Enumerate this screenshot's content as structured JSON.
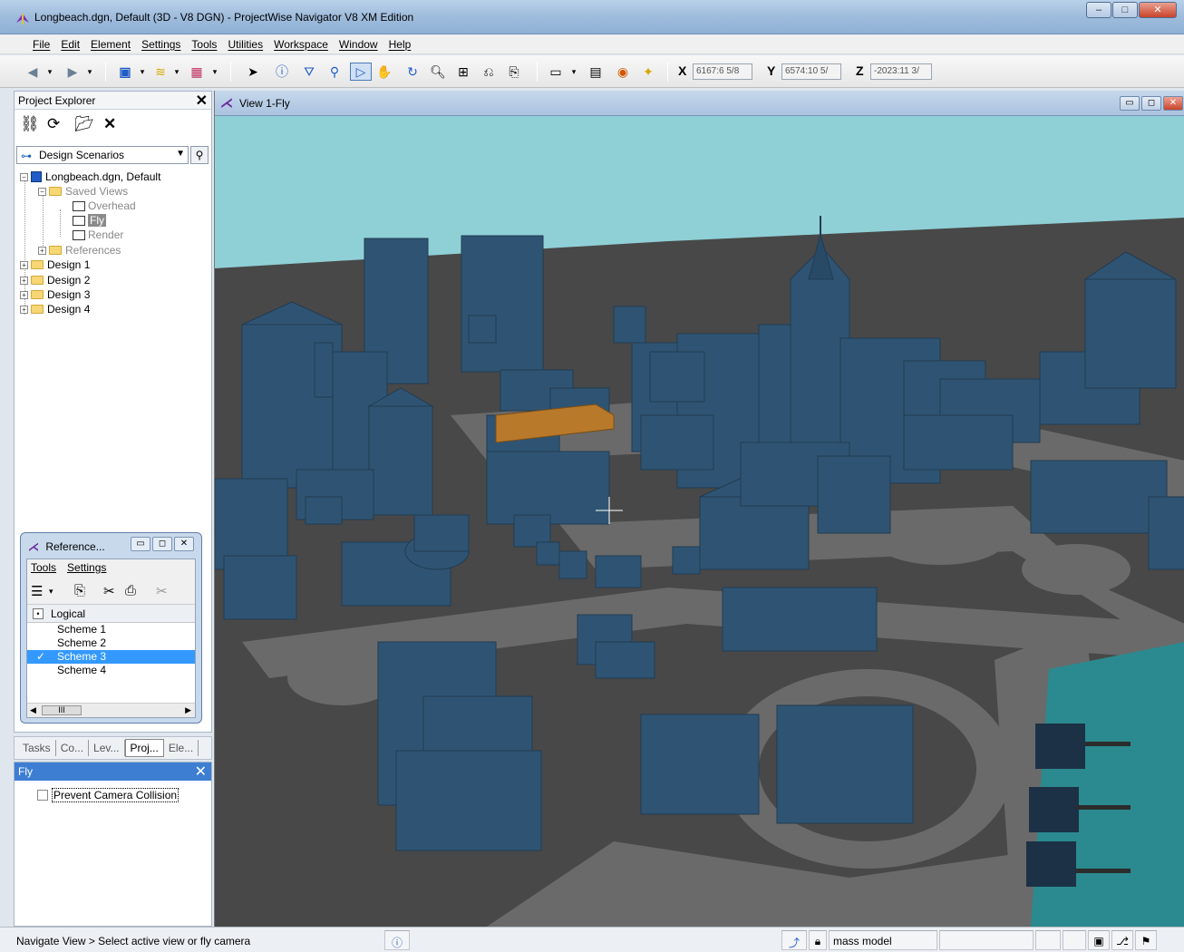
{
  "window": {
    "title": "Longbeach.dgn, Default (3D - V8 DGN) - ProjectWise Navigator V8 XM Edition",
    "buttons": [
      "–",
      "□",
      "✕"
    ]
  },
  "menu": [
    "File",
    "Edit",
    "Element",
    "Settings",
    "Tools",
    "Utilities",
    "Workspace",
    "Window",
    "Help"
  ],
  "coords": {
    "x_label": "X",
    "x_value": "6167:6 5/8",
    "y_label": "Y",
    "y_value": "6574:10 5/",
    "z_label": "Z",
    "z_value": "-2023:11 3/"
  },
  "explorer": {
    "title": "Project Explorer",
    "scenario": "Design Scenarios",
    "tree": {
      "root": "Longbeach.dgn, Default",
      "saved_views": "Saved Views",
      "overhead": "Overhead",
      "fly": "Fly",
      "render": "Render",
      "references": "References",
      "design1": "Design 1",
      "design2": "Design 2",
      "design3": "Design 3",
      "design4": "Design 4"
    }
  },
  "reference_dialog": {
    "title": "Reference...",
    "menu": [
      "Tools",
      "Settings"
    ],
    "logical": "Logical",
    "schemes": [
      "Scheme 1",
      "Scheme 2",
      "Scheme 3",
      "Scheme 4"
    ],
    "active_scheme": "Scheme 3"
  },
  "tabs": [
    "Tasks",
    "Co...",
    "Lev...",
    "Proj...",
    "Ele..."
  ],
  "active_tab": "Proj...",
  "fly_panel": {
    "title": "Fly",
    "option": "Prevent Camera Collision",
    "option_checked": false
  },
  "view": {
    "title": "View 1-Fly"
  },
  "status": {
    "prompt": "Navigate View > Select active view or fly camera",
    "level": "mass model"
  },
  "colors": {
    "building": "#2f5473",
    "highlight_building": "#b8792a",
    "ground": "#484848",
    "road": "#6a6a6a",
    "sky": "#8fd0d6",
    "water": "#2a8a8f"
  }
}
